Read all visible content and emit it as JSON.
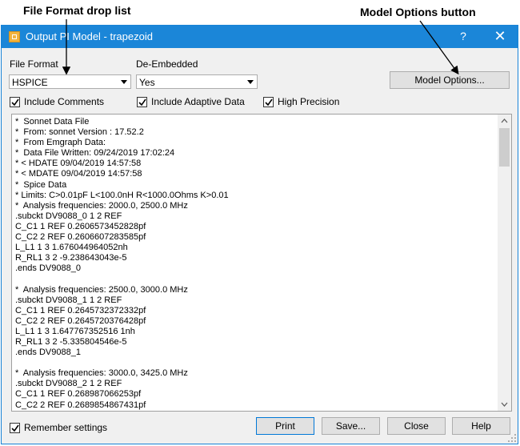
{
  "callouts": {
    "file_format": "File Format drop list",
    "model_options": "Model Options button"
  },
  "window": {
    "title": "Output PI Model - trapezoid",
    "help": "?",
    "close": "✕"
  },
  "file_format": {
    "label": "File Format",
    "value": "HSPICE"
  },
  "de_embedded": {
    "label": "De-Embedded",
    "value": "Yes"
  },
  "model_options_label": "Model Options...",
  "checkboxes": {
    "include_comments": {
      "label": "Include Comments",
      "checked": true
    },
    "include_adaptive": {
      "label": "Include Adaptive Data",
      "checked": true
    },
    "high_precision": {
      "label": "High Precision",
      "checked": true
    },
    "remember_settings": {
      "label": "Remember settings",
      "checked": true
    }
  },
  "output_text": "*  Sonnet Data File\n*  From: sonnet Version : 17.52.2\n*  From Emgraph Data:\n*  Data File Written: 09/24/2019 17:02:24\n* < HDATE 09/04/2019 14:57:58\n* < MDATE 09/04/2019 14:57:58\n*  Spice Data\n* Limits: C>0.01pF L<100.0nH R<1000.0Ohms K>0.01\n*  Analysis frequencies: 2000.0, 2500.0 MHz\n.subckt DV9088_0 1 2 REF\nC_C1 1 REF 0.2606573452828pf\nC_C2 2 REF 0.2606607283585pf\nL_L1 1 3 1.676044964052nh\nR_RL1 3 2 -9.238643043e-5\n.ends DV9088_0\n\n*  Analysis frequencies: 2500.0, 3000.0 MHz\n.subckt DV9088_1 1 2 REF\nC_C1 1 REF 0.2645732372332pf\nC_C2 2 REF 0.2645720376428pf\nL_L1 1 3 1.647767352516 1nh\nR_RL1 3 2 -5.335804546e-5\n.ends DV9088_1\n\n*  Analysis frequencies: 3000.0, 3425.0 MHz\n.subckt DV9088_2 1 2 REF\nC_C1 1 REF 0.268987066253pf\nC_C2 2 REF 0.2689854867431pf",
  "buttons": {
    "print": "Print",
    "save": "Save...",
    "close": "Close",
    "help": "Help"
  }
}
